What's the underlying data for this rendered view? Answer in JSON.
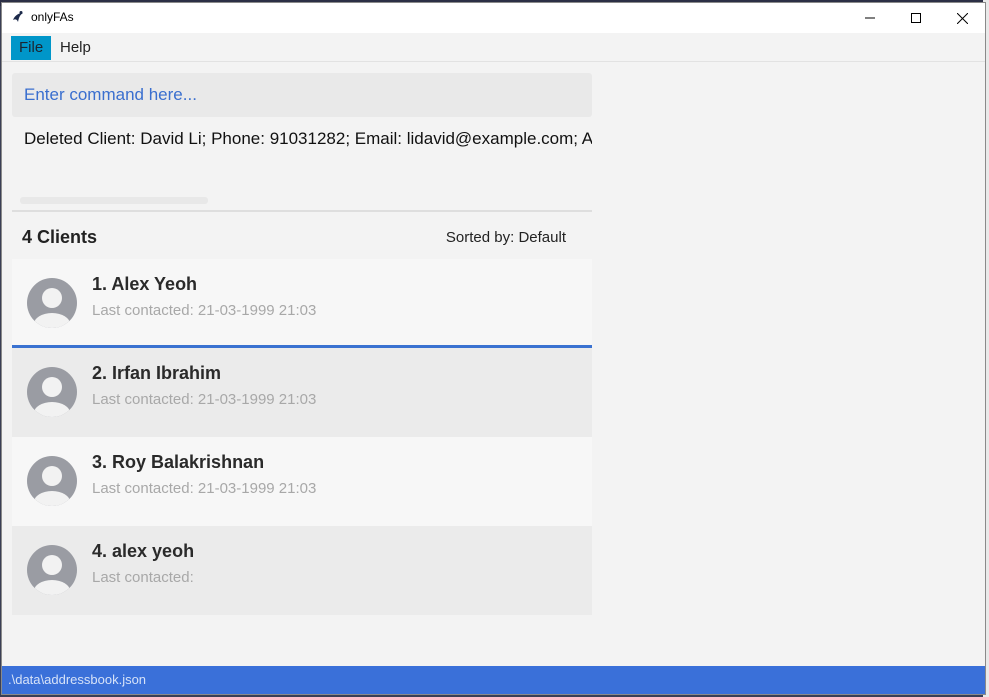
{
  "window": {
    "title": "onlyFAs"
  },
  "menu": {
    "file": "File",
    "help": "Help"
  },
  "command": {
    "placeholder": "Enter command here..."
  },
  "result": {
    "text": "Deleted Client: David Li; Phone: 91031282; Email: lidavid@example.com; Address: ..."
  },
  "list": {
    "count_label": "4 Clients",
    "sorted_by": "Sorted by: Default",
    "clients": [
      {
        "name": "1.  Alex Yeoh",
        "contact": "Last contacted: 21-03-1999 21:03"
      },
      {
        "name": "2.  Irfan Ibrahim",
        "contact": "Last contacted: 21-03-1999 21:03"
      },
      {
        "name": "3.  Roy Balakrishnan",
        "contact": "Last contacted: 21-03-1999 21:03"
      },
      {
        "name": "4.  alex yeoh",
        "contact": "Last contacted:"
      }
    ]
  },
  "status": {
    "path": ".\\data\\addressbook.json"
  },
  "colors": {
    "accent": "#3a70d9",
    "menu_active": "#0096c9",
    "selected_border": "#3a72d1"
  }
}
